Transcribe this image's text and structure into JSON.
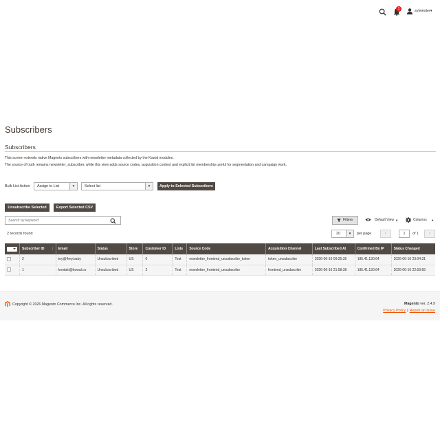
{
  "header": {
    "title": "Subscribers",
    "notifications_count": "1",
    "user_name": "sylwester"
  },
  "section": {
    "title": "Subscribers",
    "description_line1": "This screen extends native Magento subscribers with newsletter metadata collected by the Kowal modules.",
    "description_line2": "The source of truth remains newsletter_subscriber, while this view adds source codes, acquisition context and explicit list membership useful for segmentation and campaign work."
  },
  "bulk": {
    "label": "Bulk List Action",
    "action_value": "Assign to List",
    "list_value": "Select list",
    "apply_label": "Apply to Selected Subscribers"
  },
  "actions": {
    "unsubscribe_label": "Unsubscribe Selected",
    "export_label": "Export Selected CSV"
  },
  "toolbar": {
    "search_placeholder": "Search by keyword",
    "filters_label": "Filters",
    "view_label": "Default View",
    "columns_label": "Columns",
    "records_found": "2 records found",
    "per_page_value": "20",
    "per_page_label": "per page",
    "page_value": "1",
    "page_total": "of 1"
  },
  "grid": {
    "columns": [
      "Subscriber ID",
      "Email",
      "Status",
      "Store",
      "Customer ID",
      "Lists",
      "Source Code",
      "Acquisition Channel",
      "Last Subscribed At",
      "Confirmed By IP",
      "Status Changed"
    ],
    "sort_indicator": "↑",
    "rows": [
      {
        "id": "2",
        "email": "toy@4my.baby",
        "status": "Unsubscribed",
        "store": "US",
        "customer_id": "0",
        "lists": "Test",
        "source_code": "newsletter_frontend_unsubscribe_token",
        "channel": "token_unsubscribe",
        "last_subscribed": "2026-06-16 09:25:35",
        "ip": "185.41.130.64",
        "status_changed": "2026-06-16 23:04:31"
      },
      {
        "id": "1",
        "email": "kontakt@kowal.co",
        "status": "Unsubscribed",
        "store": "US",
        "customer_id": "2",
        "lists": "Test",
        "source_code": "newsletter_frontend_unsubscribe",
        "channel": "frontend_unsubscribe",
        "last_subscribed": "2026-06-16 21:58:38",
        "ip": "185.41.130.64",
        "status_changed": "2026-06-16 22:59:55"
      }
    ]
  },
  "footer": {
    "copyright": "Copyright © 2026 Magento Commerce Inc. All rights reserved.",
    "brand": "Magento",
    "version": " ver. 2.4.9",
    "privacy_label": "Privacy Policy",
    "report_label": "Report an Issue",
    "separator": "|"
  },
  "colors": {
    "accent": "#eb5202",
    "dark_button": "#514943",
    "badge": "#e22626"
  }
}
